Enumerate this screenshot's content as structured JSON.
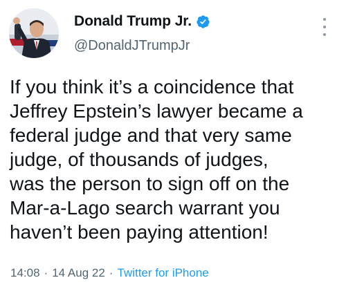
{
  "colors": {
    "text": "#0f1419",
    "secondary": "#536471",
    "accent": "#1d9bf0",
    "background": "#ffffff"
  },
  "tweet": {
    "author": {
      "display_name": "Donald Trump Jr.",
      "handle": "@DonaldJTrumpJr",
      "verified_icon": "verified-badge-icon",
      "avatar": "profile-photo"
    },
    "more_icon": "more-options-icon",
    "text_lines": [
      "If you think it’s a coincidence that",
      "Jeffrey Epstein’s lawyer became a",
      "federal judge and that very same",
      "judge, of thousands of judges,",
      "was the person to sign off on the",
      "Mar-a-Lago search warrant you",
      "haven’t been paying attention!"
    ],
    "meta": {
      "time": "14:08",
      "separator": "·",
      "date": "14 Aug 22",
      "source": "Twitter for iPhone"
    }
  }
}
